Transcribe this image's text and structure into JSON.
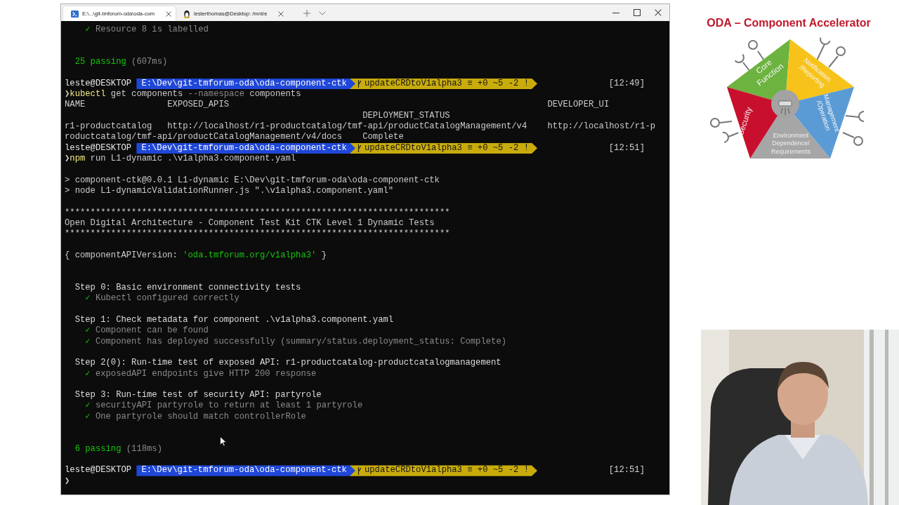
{
  "window": {
    "tabs": [
      {
        "kind": "powershell",
        "label": "E:\\...\\git-tmforum-oda\\oda-com",
        "selected": true
      },
      {
        "kind": "linux",
        "label": "lesterthomas@Desktop: /mnt/e",
        "selected": false
      }
    ]
  },
  "terminal": {
    "lines": [
      {
        "kind": "check",
        "mark": "✓",
        "text": "Resource 8 is labelled"
      },
      {
        "kind": "blank"
      },
      {
        "kind": "blank"
      },
      {
        "kind": "summary",
        "count": "25 passing",
        "time": "(607ms)"
      },
      {
        "kind": "blank"
      },
      {
        "kind": "prompt",
        "user": "leste@DESKTOP",
        "path": "E:\\Dev\\git-tmforum-oda\\oda-component-ctk",
        "branch": "updateCRDtoV1alpha3",
        "status": "≡ +0 ~5 -2 !",
        "time": "[12:49]"
      },
      {
        "kind": "command",
        "symbol": "❯",
        "segments": [
          {
            "text": "kubectl",
            "kind": "program"
          },
          {
            "text": " get components ",
            "kind": "argument"
          },
          {
            "text": "--namespace",
            "kind": "flag"
          },
          {
            "text": " components",
            "kind": "argument"
          }
        ]
      },
      {
        "kind": "text",
        "text": "NAME                EXPOSED_APIS                                                              DEVELOPER_UI"
      },
      {
        "kind": "text",
        "text": "                                                          DEPLOYMENT_STATUS"
      },
      {
        "kind": "text",
        "text": "r1-productcatalog   http://localhost/r1-productcatalog/tmf-api/productCatalogManagement/v4    http://localhost/r1-p"
      },
      {
        "kind": "text",
        "text": "roductcatalog/tmf-api/productCatalogManagement/v4/docs    Complete"
      },
      {
        "kind": "prompt",
        "user": "leste@DESKTOP",
        "path": "E:\\Dev\\git-tmforum-oda\\oda-component-ctk",
        "branch": "updateCRDtoV1alpha3",
        "status": "≡ +0 ~5 -2 !",
        "time": "[12:51]"
      },
      {
        "kind": "command",
        "symbol": "❯",
        "segments": [
          {
            "text": "npm",
            "kind": "program"
          },
          {
            "text": " run L1-dynamic .\\v1alpha3.component.yaml",
            "kind": "argument"
          }
        ]
      },
      {
        "kind": "blank"
      },
      {
        "kind": "text",
        "text": "> component-ctk@0.0.1 L1-dynamic E:\\Dev\\git-tmforum-oda\\oda-component-ctk"
      },
      {
        "kind": "text",
        "text": "> node L1-dynamicValidationRunner.js \".\\v1alpha3.component.yaml\""
      },
      {
        "kind": "blank"
      },
      {
        "kind": "text",
        "text": "***************************************************************************"
      },
      {
        "kind": "text",
        "text": "Open Digital Architecture - Component Test Kit CTK Level 1 Dynamic Tests"
      },
      {
        "kind": "text",
        "text": "***************************************************************************"
      },
      {
        "kind": "blank"
      },
      {
        "kind": "line",
        "segments": [
          {
            "text": "{ componentAPIVersion: ",
            "kind": "argument"
          },
          {
            "text": "'oda.tmforum.org/v1alpha3'",
            "kind": "string"
          },
          {
            "text": " }",
            "kind": "argument"
          }
        ]
      },
      {
        "kind": "blank"
      },
      {
        "kind": "blank"
      },
      {
        "kind": "step",
        "text": "Step 0: Basic environment connectivity tests"
      },
      {
        "kind": "check",
        "mark": "✓",
        "text": "Kubectl configured correctly"
      },
      {
        "kind": "blank"
      },
      {
        "kind": "step",
        "text": "Step 1: Check metadata for component .\\v1alpha3.component.yaml"
      },
      {
        "kind": "check",
        "mark": "✓",
        "text": "Component can be found"
      },
      {
        "kind": "check",
        "mark": "✓",
        "text": "Component has deployed successfully (summary/status.deployment_status: Complete)"
      },
      {
        "kind": "blank"
      },
      {
        "kind": "step",
        "text": "Step 2(0): Run-time test of exposed API: r1-productcatalog-productcatalogmanagement"
      },
      {
        "kind": "check",
        "mark": "✓",
        "text": "exposedAPI endpoints give HTTP 200 response"
      },
      {
        "kind": "blank"
      },
      {
        "kind": "step",
        "text": "Step 3: Run-time test of security API: partyrole"
      },
      {
        "kind": "check",
        "mark": "✓",
        "text": "securityAPI partyrole to return at least 1 partyrole"
      },
      {
        "kind": "check",
        "mark": "✓",
        "text": "One partyrole should match controllerRole"
      },
      {
        "kind": "blank"
      },
      {
        "kind": "blank"
      },
      {
        "kind": "summary",
        "count": "6 passing",
        "time": "(118ms)"
      },
      {
        "kind": "blank"
      },
      {
        "kind": "prompt",
        "user": "leste@DESKTOP",
        "path": "E:\\Dev\\git-tmforum-oda\\oda-component-ctk",
        "branch": "updateCRDtoV1alpha3",
        "status": "≡ +0 ~5 -2 !",
        "time": "[12:51]"
      },
      {
        "kind": "input",
        "symbol": "❯"
      }
    ]
  },
  "diagram": {
    "title": "ODA – Component Accelerator",
    "segments": [
      {
        "label_lines": [
          "Core",
          "Function"
        ],
        "color": "#6db33f"
      },
      {
        "label_lines": [
          "Notification",
          "/Reporting"
        ],
        "color": "#f7c31a"
      },
      {
        "label_lines": [
          "Management",
          "/Operation"
        ],
        "color": "#5b9bd5"
      },
      {
        "label_lines": [
          "Environment",
          "Dependence/",
          "Requirements"
        ],
        "color": "#a6a6a6"
      },
      {
        "label_lines": [
          "Security"
        ],
        "color": "#c8102e"
      }
    ]
  }
}
